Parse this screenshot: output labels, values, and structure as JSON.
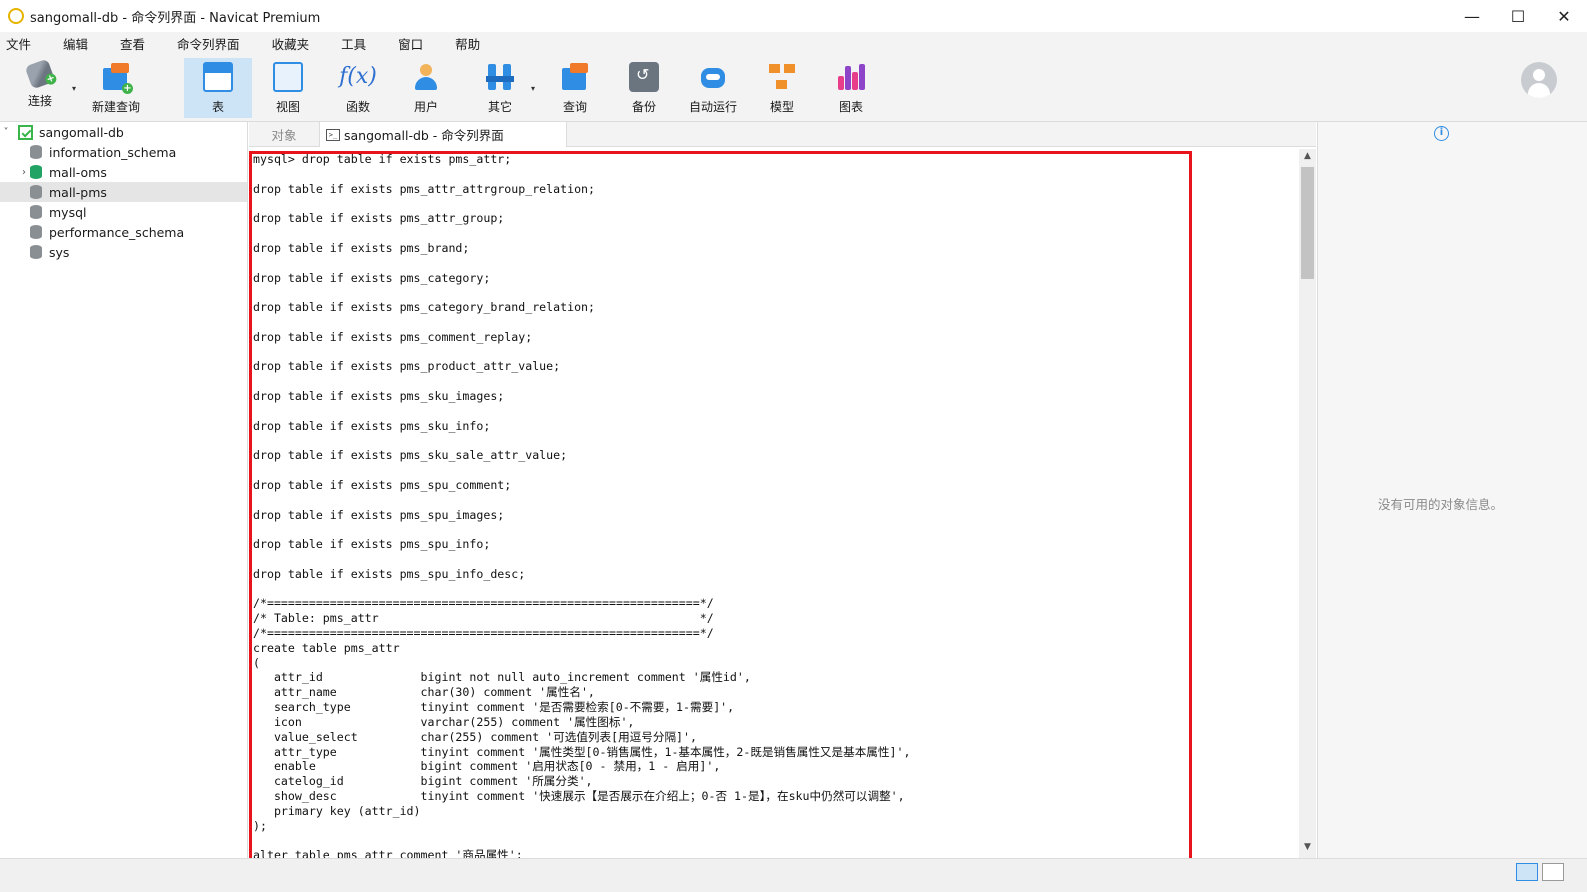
{
  "window": {
    "title": "sangomall-db - 命令列界面 - Navicat Premium",
    "controls": {
      "minimize": "—",
      "maximize": "☐",
      "close": "✕"
    }
  },
  "menu": [
    "文件",
    "编辑",
    "查看",
    "命令列界面",
    "收藏夹",
    "工具",
    "窗口",
    "帮助"
  ],
  "toolbar": {
    "connect": "连接",
    "new_query": "新建查询",
    "table": "表",
    "view": "视图",
    "function": "函数",
    "function_glyph": "f(x)",
    "user": "用户",
    "other": "其它",
    "query": "查询",
    "backup": "备份",
    "automation": "自动运行",
    "model": "模型",
    "chart": "图表",
    "dropdown_glyph": "▾",
    "active": "table"
  },
  "sidebar": {
    "connection": "sangomall-db",
    "databases": [
      {
        "name": "information_schema",
        "expander": "",
        "color": "#8a8f94"
      },
      {
        "name": "mall-oms",
        "expander": "›",
        "color": "#21a366"
      },
      {
        "name": "mall-pms",
        "expander": "",
        "color": "#8a8f94"
      },
      {
        "name": "mysql",
        "expander": "",
        "color": "#8a8f94"
      },
      {
        "name": "performance_schema",
        "expander": "",
        "color": "#8a8f94"
      },
      {
        "name": "sys",
        "expander": "",
        "color": "#8a8f94"
      }
    ],
    "selected": "mall-pms",
    "collapse_glyph": "˅"
  },
  "tabs": {
    "objects": "对象",
    "console": "sangomall-db - 命令列界面",
    "console_icon": ">_"
  },
  "console": {
    "lines": [
      "mysql> drop table if exists pms_attr;",
      "",
      "drop table if exists pms_attr_attrgroup_relation;",
      "",
      "drop table if exists pms_attr_group;",
      "",
      "drop table if exists pms_brand;",
      "",
      "drop table if exists pms_category;",
      "",
      "drop table if exists pms_category_brand_relation;",
      "",
      "drop table if exists pms_comment_replay;",
      "",
      "drop table if exists pms_product_attr_value;",
      "",
      "drop table if exists pms_sku_images;",
      "",
      "drop table if exists pms_sku_info;",
      "",
      "drop table if exists pms_sku_sale_attr_value;",
      "",
      "drop table if exists pms_spu_comment;",
      "",
      "drop table if exists pms_spu_images;",
      "",
      "drop table if exists pms_spu_info;",
      "",
      "drop table if exists pms_spu_info_desc;",
      "",
      "/*==============================================================*/",
      "/* Table: pms_attr                                              */",
      "/*==============================================================*/",
      "create table pms_attr",
      "(",
      "   attr_id              bigint not null auto_increment comment '属性id',",
      "   attr_name            char(30) comment '属性名',",
      "   search_type          tinyint comment '是否需要检索[0-不需要，1-需要]',",
      "   icon                 varchar(255) comment '属性图标',",
      "   value_select         char(255) comment '可选值列表[用逗号分隔]',",
      "   attr_type            tinyint comment '属性类型[0-销售属性，1-基本属性，2-既是销售属性又是基本属性]',",
      "   enable               bigint comment '启用状态[0 - 禁用，1 - 启用]',",
      "   catelog_id           bigint comment '所属分类',",
      "   show_desc            tinyint comment '快速展示【是否展示在介绍上；0-否 1-是】，在sku中仍然可以调整',",
      "   primary key (attr_id)",
      ");",
      "",
      "alter table pms_attr comment '商品属性';"
    ]
  },
  "scrollbar": {
    "up": "▲",
    "down": "▼"
  },
  "info_panel": {
    "icon": "i",
    "empty_text": "没有可用的对象信息。"
  }
}
